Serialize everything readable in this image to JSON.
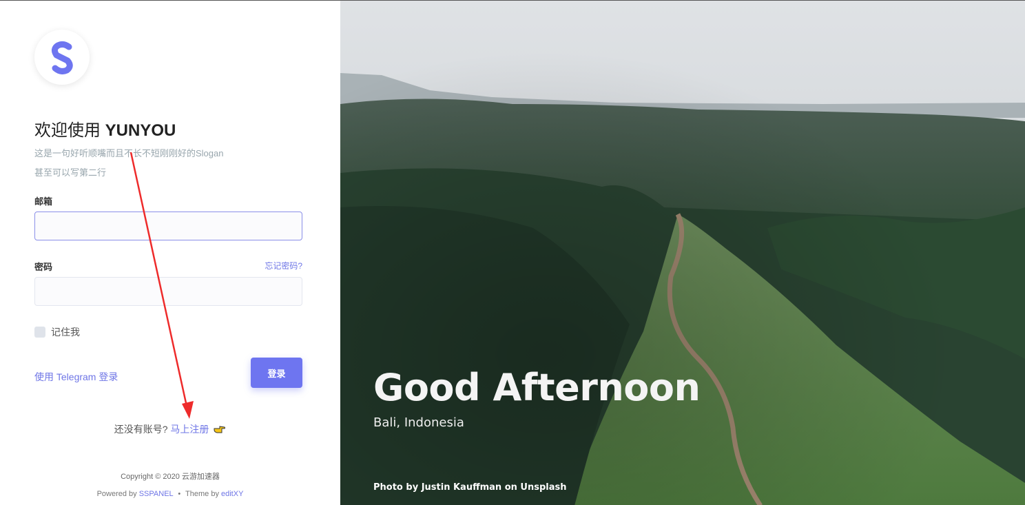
{
  "brand": {
    "logo_letter": "S",
    "accent": "#6e75f0"
  },
  "welcome": {
    "prefix": "欢迎使用 ",
    "name": "YUNYOU"
  },
  "slogan": {
    "line1": "这是一句好听顺嘴而且不长不短刚刚好的Slogan",
    "line2": "甚至可以写第二行"
  },
  "form": {
    "email_label": "邮箱",
    "email_value": "",
    "password_label": "密码",
    "password_value": "",
    "forgot_label": "忘记密码?",
    "remember_label": "记住我",
    "remember_checked": false,
    "telegram_label": "使用 Telegram 登录",
    "login_label": "登录"
  },
  "signup": {
    "prompt": "还没有账号?",
    "link": "马上注册",
    "icon": "pointing-hand-icon"
  },
  "footer": {
    "copyright": "Copyright © 2020 云游加速器",
    "powered_prefix": "Powered by ",
    "powered_link": "SSPANEL",
    "separator": "•",
    "theme_prefix": "Theme by ",
    "theme_link": "editXY"
  },
  "hero": {
    "greeting": "Good Afternoon",
    "location": "Bali, Indonesia",
    "credit": "Photo by Justin Kauffman on Unsplash"
  }
}
